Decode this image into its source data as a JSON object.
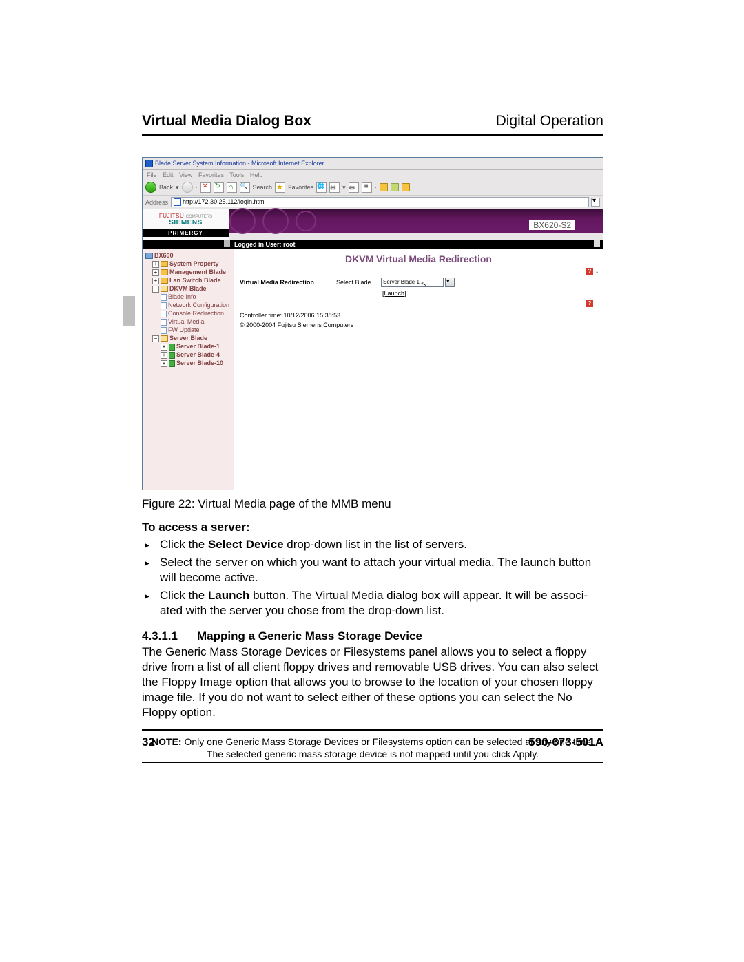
{
  "header": {
    "left": "Virtual Media Dialog Box",
    "right": "Digital Operation"
  },
  "screenshot": {
    "titlebar": "Blade Server System Information - Microsoft Internet Explorer",
    "menus": [
      "File",
      "Edit",
      "View",
      "Favorites",
      "Tools",
      "Help"
    ],
    "toolbar": {
      "back": "Back",
      "search": "Search",
      "favorites": "Favorites"
    },
    "address": {
      "label": "Address",
      "value": "http://172.30.25.112/login.htm"
    },
    "brand": {
      "fujitsu": "FUJITSU",
      "computers": "COMPUTERS",
      "siemens": "SIEMENS",
      "primergy": "PRIMERGY"
    },
    "model": "BX620-S2",
    "statusbar": "Logged in User: root",
    "nav": {
      "root": "BX600",
      "items": [
        "System Property",
        "Management Blade",
        "Lan Switch Blade"
      ],
      "dkvm": "DKVM Blade",
      "dkvm_children": [
        "Blade Info",
        "Network Configuration",
        "Console Redirection",
        "Virtual Media",
        "FW Update"
      ],
      "server": "Server Blade",
      "server_children": [
        "Server Blade-1",
        "Server Blade-4",
        "Server Blade-10"
      ]
    },
    "pane": {
      "title": "DKVM Virtual Media Redirection",
      "row_label": "Virtual Media Redirection",
      "select_label": "Select Blade",
      "select_value": "Server Blade 1",
      "launch": "[Launch]",
      "controller": "Controller time: 10/12/2006 15:38:53",
      "copyright": "© 2000-2004 Fujitsu Siemens Computers"
    }
  },
  "caption": "Figure 22: Virtual Media page of the MMB menu",
  "access_heading": "To access a server:",
  "bullets": {
    "b1a": "Click the ",
    "b1b": "Select Device",
    "b1c": " drop-down list in the list of servers.",
    "b2": "Select the server on which you want to attach your virtual media. The launch button will become active.",
    "b3a": "Click the ",
    "b3b": "Launch",
    "b3c": " button. The Virtual Media dialog box will appear. It will be associ­ated with the server you chose from the drop-down list."
  },
  "subsection": {
    "num": "4.3.1.1",
    "title": "Mapping a Generic Mass Storage Device"
  },
  "paragraph": "The Generic Mass Storage Devices or Filesystems panel allows you to select a floppy drive from a list of all client floppy drives and removable USB drives. You can also select the Floppy Image option that allows you to browse to the location of your chosen floppy image file. If you do not want to select either of these options you can select the No Floppy option.",
  "note": {
    "label": "NOTE:",
    "text": " Only one Generic Mass Storage Devices or Filesystems option can be selected at any one time. The selected generic mass storage device is not mapped until you click Apply."
  },
  "footer": {
    "page": "32",
    "doc": "590-673-501A"
  }
}
